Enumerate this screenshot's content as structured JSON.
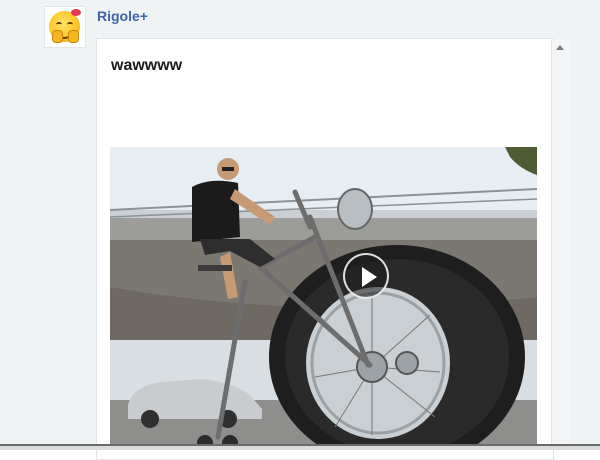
{
  "post": {
    "author": "Rigole+",
    "text": "wawwww",
    "avatar_icon": "smiley-face-icon",
    "media_type": "video",
    "play_icon": "play-icon"
  },
  "colors": {
    "author_link": "#3f63a8",
    "page_background": "#f0f3f4"
  }
}
